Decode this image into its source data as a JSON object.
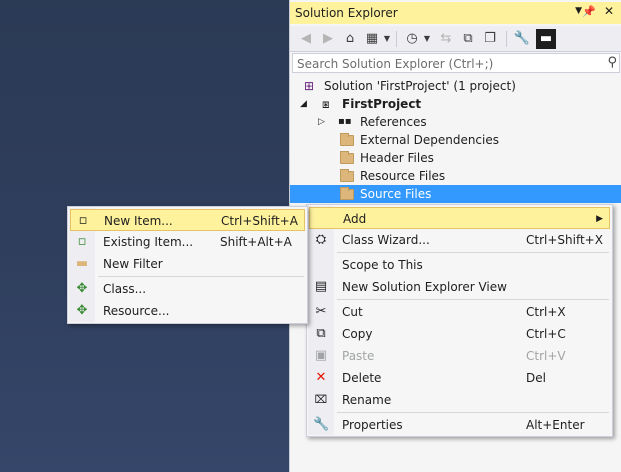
{
  "solution_explorer": {
    "title": "Solution Explorer",
    "search_placeholder": "Search Solution Explorer (Ctrl+;)",
    "toolbar_icons": [
      "back-icon",
      "forward-icon",
      "home-icon",
      "switch-views-icon",
      "history-icon",
      "sync-icon",
      "collapse-all-icon",
      "show-all-files-icon",
      "properties-icon",
      "preview-icon"
    ],
    "tree": [
      {
        "label": "Solution 'FirstProject' (1 project)",
        "icon": "solution-icon"
      },
      {
        "label": "FirstProject",
        "icon": "project-icon",
        "bold": true,
        "expanded": true
      },
      {
        "label": "References",
        "icon": "references-icon",
        "collapsed": true
      },
      {
        "label": "External Dependencies",
        "icon": "external-deps-icon"
      },
      {
        "label": "Header Files",
        "icon": "folder-icon"
      },
      {
        "label": "Resource Files",
        "icon": "folder-icon"
      },
      {
        "label": "Source Files",
        "icon": "folder-icon",
        "selected": true
      }
    ]
  },
  "context_menu": {
    "items": [
      {
        "label": "Add",
        "submenu": true,
        "highlighted": true
      },
      {
        "label": "Class Wizard...",
        "shortcut": "Ctrl+Shift+X",
        "icon": "class-wizard-icon"
      },
      {
        "label": "Scope to This"
      },
      {
        "label": "New Solution Explorer View",
        "icon": "new-view-icon"
      },
      {
        "label": "Cut",
        "shortcut": "Ctrl+X",
        "icon": "cut-icon"
      },
      {
        "label": "Copy",
        "shortcut": "Ctrl+C",
        "icon": "copy-icon"
      },
      {
        "label": "Paste",
        "shortcut": "Ctrl+V",
        "icon": "paste-icon",
        "disabled": true
      },
      {
        "label": "Delete",
        "shortcut": "Del",
        "icon": "delete-icon"
      },
      {
        "label": "Rename",
        "icon": "rename-icon"
      },
      {
        "label": "Properties",
        "shortcut": "Alt+Enter",
        "icon": "wrench-icon"
      }
    ]
  },
  "add_submenu": {
    "items": [
      {
        "label": "New Item...",
        "shortcut": "Ctrl+Shift+A",
        "icon": "new-item-icon",
        "highlighted": true
      },
      {
        "label": "Existing Item...",
        "shortcut": "Shift+Alt+A",
        "icon": "existing-item-icon"
      },
      {
        "label": "New Filter",
        "icon": "new-filter-icon"
      },
      {
        "label": "Class...",
        "icon": "class-icon"
      },
      {
        "label": "Resource...",
        "icon": "resource-icon"
      }
    ]
  },
  "colors": {
    "background": "#2f3e5c",
    "title_bar": "#fff29d",
    "selection": "#3399ff",
    "menu_highlight": "#fff29d",
    "delete_red": "#e51400"
  }
}
